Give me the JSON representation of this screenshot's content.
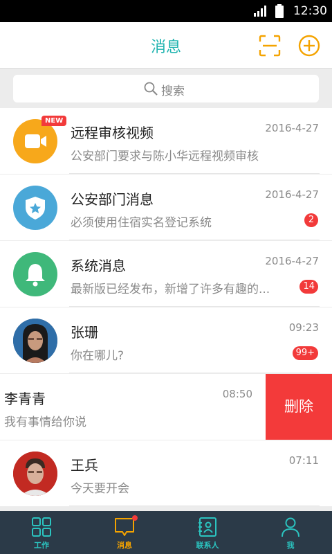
{
  "status_bar": {
    "time": "12:30"
  },
  "header": {
    "title": "消息"
  },
  "search": {
    "placeholder": "搜索"
  },
  "conversations": [
    {
      "name": "远程审核视频",
      "preview": "公安部门要求与陈小华远程视频审核",
      "date": "2016-4-27",
      "tag": "NEW",
      "avatar_icon": "video-camera-icon",
      "avatar_color": "#f7a81b"
    },
    {
      "name": "公安部门消息",
      "preview": "必须使用住宿实名登记系统",
      "date": "2016-4-27",
      "badge": "2",
      "avatar_icon": "police-shield-icon",
      "avatar_color": "#4aa8d8"
    },
    {
      "name": "系统消息",
      "preview": "最新版已经发布，新增了许多有趣的...",
      "date": "2016-4-27",
      "badge": "14",
      "avatar_icon": "bell-icon",
      "avatar_color": "#3fb87a"
    },
    {
      "name": "张珊",
      "preview": "你在哪儿?",
      "date": "09:23",
      "badge": "99+",
      "avatar_icon": "user-photo",
      "avatar_color": "#3a5f86"
    },
    {
      "name": "李青青",
      "preview": "我有事情给你说",
      "date": "08:50",
      "delete_label": "删除"
    },
    {
      "name": "王兵",
      "preview": "今天要开会",
      "date": "07:11",
      "avatar_icon": "user-photo",
      "avatar_color": "#c22a22"
    }
  ],
  "tabs": [
    {
      "label": "工作",
      "icon": "grid-icon",
      "active": false
    },
    {
      "label": "消息",
      "icon": "message-icon",
      "active": true
    },
    {
      "label": "联系人",
      "icon": "contacts-icon",
      "active": false
    },
    {
      "label": "我",
      "icon": "person-icon",
      "active": false
    }
  ],
  "colors": {
    "accent": "#20b4b0",
    "active_tab": "#f4a300",
    "badge": "#f23a3a",
    "tabbar_bg": "#2b3a48"
  }
}
